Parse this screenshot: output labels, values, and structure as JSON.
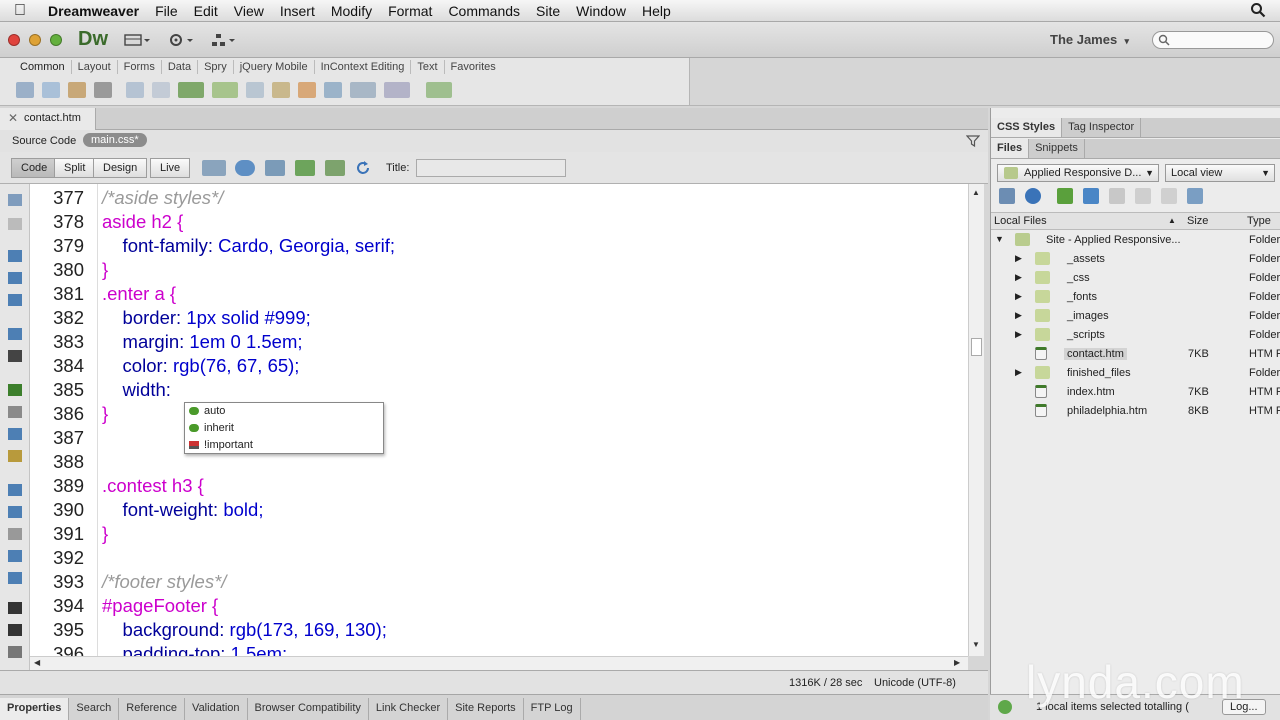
{
  "menubar": {
    "app": "Dreamweaver",
    "items": [
      "File",
      "Edit",
      "View",
      "Insert",
      "Modify",
      "Format",
      "Commands",
      "Site",
      "Window",
      "Help"
    ]
  },
  "appbar": {
    "logo": "Dw",
    "workspace": "The James",
    "colors": {
      "close": "#e0443e",
      "minimize": "#dea236",
      "zoom": "#64b03e",
      "logo": "#3b6b2b"
    }
  },
  "insert_panel": {
    "tabs": [
      "Common",
      "Layout",
      "Forms",
      "Data",
      "Spry",
      "jQuery Mobile",
      "InContext Editing",
      "Text",
      "Favorites"
    ]
  },
  "document": {
    "tab": "contact.htm",
    "source_code": "Source Code",
    "related_file": "main.css*",
    "view_buttons": [
      "Code",
      "Split",
      "Design",
      "Live"
    ],
    "title_label": "Title:",
    "title_value": ""
  },
  "code_lines": [
    {
      "n": "377",
      "parts": [
        {
          "t": "/*aside styles*/",
          "c": "com"
        }
      ]
    },
    {
      "n": "378",
      "parts": [
        {
          "t": "aside h2 {",
          "c": "sel"
        }
      ]
    },
    {
      "n": "379",
      "parts": [
        {
          "t": "    font-family: ",
          "c": "prop"
        },
        {
          "t": "Cardo, Georgia, serif;",
          "c": "val"
        }
      ]
    },
    {
      "n": "380",
      "parts": [
        {
          "t": "}",
          "c": "sel"
        }
      ]
    },
    {
      "n": "381",
      "parts": [
        {
          "t": ".enter a {",
          "c": "sel"
        }
      ]
    },
    {
      "n": "382",
      "parts": [
        {
          "t": "    border: ",
          "c": "prop"
        },
        {
          "t": "1px solid #999;",
          "c": "val"
        }
      ]
    },
    {
      "n": "383",
      "parts": [
        {
          "t": "    margin: ",
          "c": "prop"
        },
        {
          "t": "1em 0 1.5em;",
          "c": "val"
        }
      ]
    },
    {
      "n": "384",
      "parts": [
        {
          "t": "    color: ",
          "c": "prop"
        },
        {
          "t": "rgb(76, 67, 65);",
          "c": "val"
        }
      ]
    },
    {
      "n": "385",
      "parts": [
        {
          "t": "    width: ",
          "c": "prop"
        }
      ]
    },
    {
      "n": "386",
      "parts": [
        {
          "t": "}",
          "c": "sel"
        }
      ]
    },
    {
      "n": "387",
      "parts": []
    },
    {
      "n": "388",
      "parts": []
    },
    {
      "n": "389",
      "parts": [
        {
          "t": ".contest h3 {",
          "c": "sel"
        }
      ]
    },
    {
      "n": "390",
      "parts": [
        {
          "t": "    font-weight: ",
          "c": "prop"
        },
        {
          "t": "bold;",
          "c": "val"
        }
      ]
    },
    {
      "n": "391",
      "parts": [
        {
          "t": "}",
          "c": "sel"
        }
      ]
    },
    {
      "n": "392",
      "parts": []
    },
    {
      "n": "393",
      "parts": [
        {
          "t": "/*footer styles*/",
          "c": "com"
        }
      ]
    },
    {
      "n": "394",
      "parts": [
        {
          "t": "#pageFooter {",
          "c": "sel"
        }
      ]
    },
    {
      "n": "395",
      "parts": [
        {
          "t": "    background: ",
          "c": "prop"
        },
        {
          "t": "rgb(173, 169, 130);",
          "c": "val"
        }
      ]
    },
    {
      "n": "396",
      "parts": [
        {
          "t": "    padding-top: ",
          "c": "prop"
        },
        {
          "t": "1.5em;",
          "c": "val"
        }
      ]
    }
  ],
  "code_hints": [
    "auto",
    "inherit",
    "!important"
  ],
  "status": {
    "size": "1316K / 28 sec",
    "encoding": "Unicode (UTF-8)"
  },
  "bottom_tabs": [
    "Properties",
    "Search",
    "Reference",
    "Validation",
    "Browser Compatibility",
    "Link Checker",
    "Site Reports",
    "FTP Log"
  ],
  "right_panel": {
    "tabs_top": [
      "CSS Styles",
      "Tag Inspector"
    ],
    "tabs_files": [
      "Files",
      "Snippets"
    ],
    "site_select": "Applied Responsive D...",
    "view_select": "Local view",
    "headers": {
      "name": "Local Files",
      "size": "Size",
      "type": "Type"
    },
    "files": [
      {
        "name": "Site - Applied Responsive...",
        "size": "",
        "type": "Folder",
        "level": 0,
        "kind": "site",
        "expander": "open"
      },
      {
        "name": "_assets",
        "size": "",
        "type": "Folder",
        "level": 1,
        "kind": "folder",
        "expander": "closed"
      },
      {
        "name": "_css",
        "size": "",
        "type": "Folder",
        "level": 1,
        "kind": "folder",
        "expander": "closed"
      },
      {
        "name": "_fonts",
        "size": "",
        "type": "Folder",
        "level": 1,
        "kind": "folder",
        "expander": "closed"
      },
      {
        "name": "_images",
        "size": "",
        "type": "Folder",
        "level": 1,
        "kind": "folder",
        "expander": "closed"
      },
      {
        "name": "_scripts",
        "size": "",
        "type": "Folder",
        "level": 1,
        "kind": "folder",
        "expander": "closed"
      },
      {
        "name": "contact.htm",
        "size": "7KB",
        "type": "HTM F",
        "level": 1,
        "kind": "file",
        "expander": "",
        "selected": true
      },
      {
        "name": "finished_files",
        "size": "",
        "type": "Folder",
        "level": 1,
        "kind": "folder",
        "expander": "closed"
      },
      {
        "name": "index.htm",
        "size": "7KB",
        "type": "HTM F",
        "level": 1,
        "kind": "file",
        "expander": ""
      },
      {
        "name": "philadelphia.htm",
        "size": "8KB",
        "type": "HTM F",
        "level": 1,
        "kind": "file",
        "expander": ""
      }
    ],
    "status": "1 local items selected totalling (",
    "log_button": "Log..."
  },
  "watermark": "lynda.com"
}
